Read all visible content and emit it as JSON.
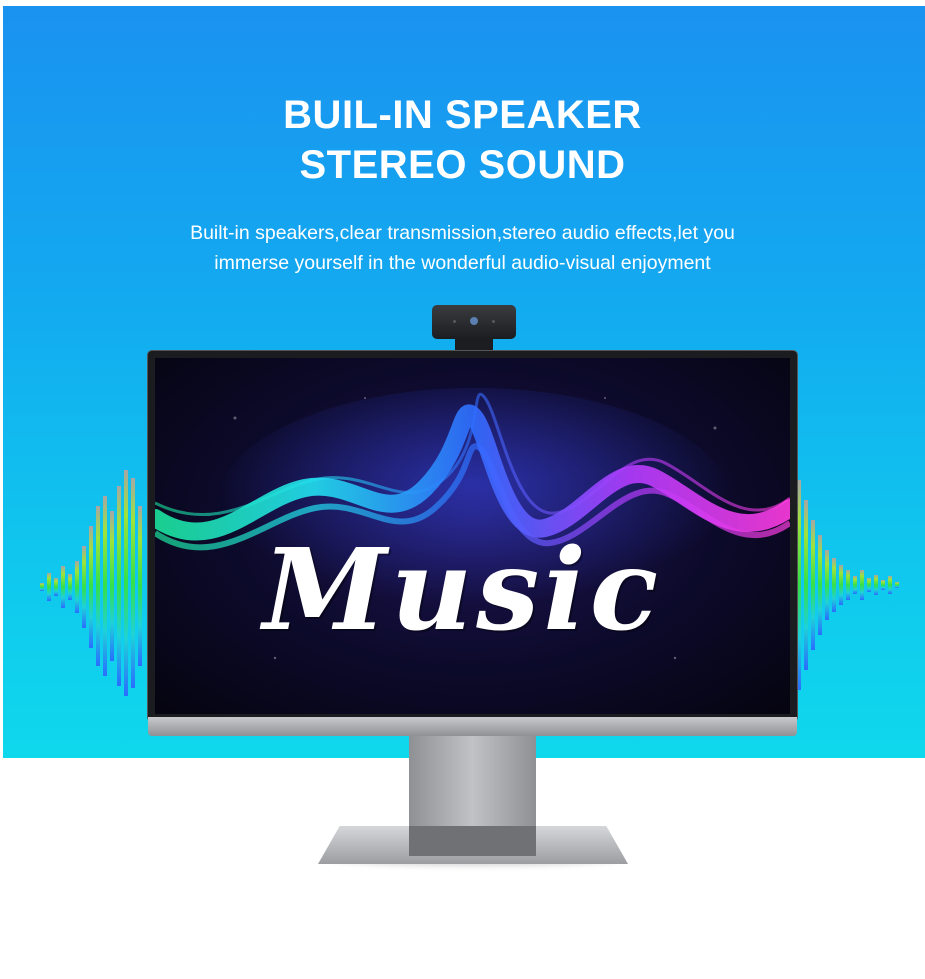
{
  "headline": {
    "line1": "BUIL-IN SPEAKER",
    "line2": "STEREO SOUND"
  },
  "description": {
    "line1": "Built-in speakers,clear transmission,stereo audio effects,let you",
    "line2": "immerse yourself in the wonderful audio-visual enjoyment"
  },
  "screen": {
    "text": "Music"
  },
  "colors": {
    "banner_top": "#1a92f0",
    "banner_bottom": "#0fd8ec",
    "text": "#ffffff",
    "wave_cyan": "#22e0f0",
    "wave_blue": "#2f6dff",
    "wave_magenta": "#ff3be0"
  },
  "icons": [
    "webcam-icon",
    "sound-equalizer-icon"
  ]
}
